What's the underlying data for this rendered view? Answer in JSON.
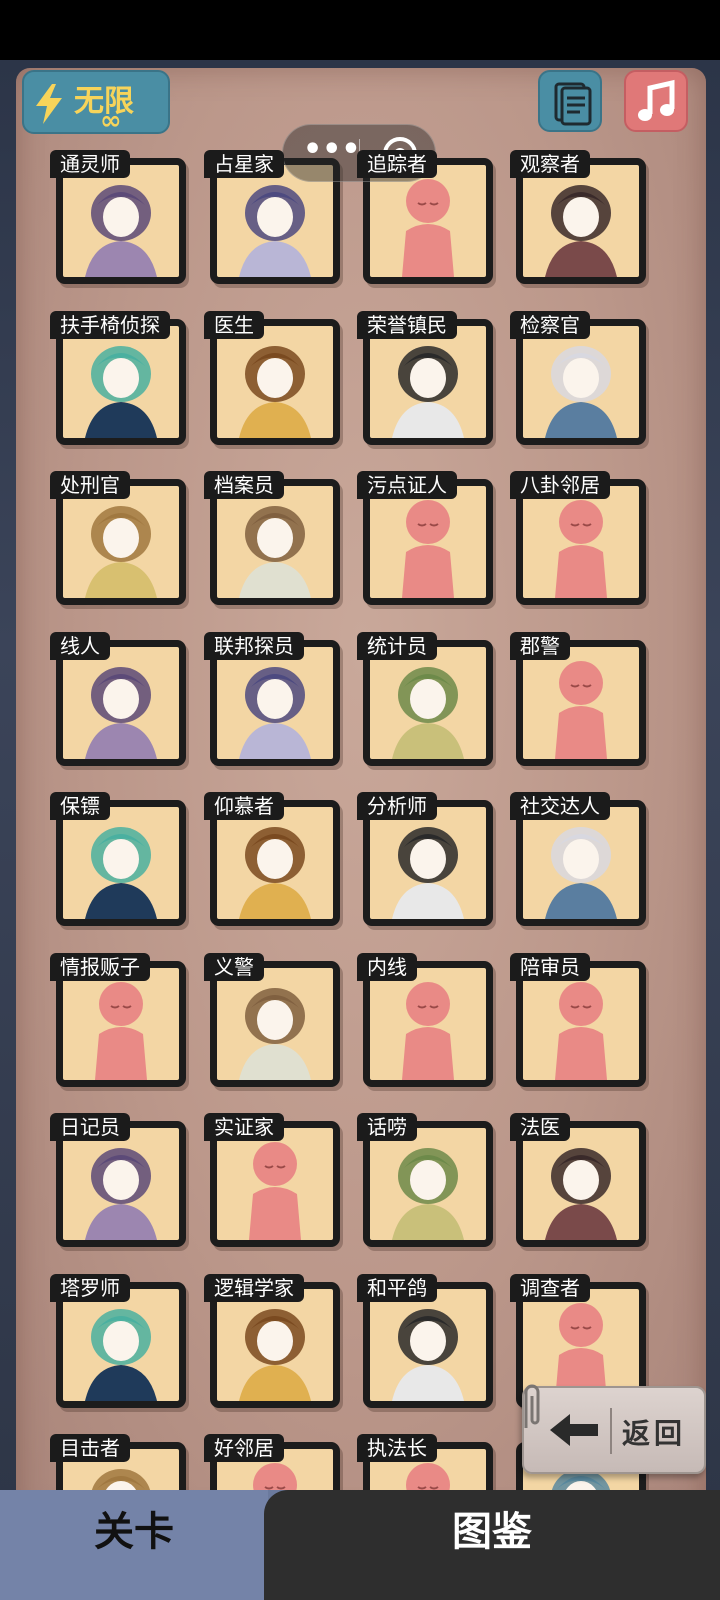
{
  "energy": {
    "label": "无限",
    "value": "∞"
  },
  "toolbar": {
    "notes_icon": "notes-icon",
    "music_icon": "music-note-icon"
  },
  "cards": [
    {
      "name": "通灵师",
      "figure": "portrait"
    },
    {
      "name": "占星家",
      "figure": "portrait"
    },
    {
      "name": "追踪者",
      "figure": "stickman"
    },
    {
      "name": "观察者",
      "figure": "portrait"
    },
    {
      "name": "扶手椅侦探",
      "figure": "portrait"
    },
    {
      "name": "医生",
      "figure": "portrait"
    },
    {
      "name": "荣誉镇民",
      "figure": "portrait"
    },
    {
      "name": "检察官",
      "figure": "portrait"
    },
    {
      "name": "处刑官",
      "figure": "portrait"
    },
    {
      "name": "档案员",
      "figure": "portrait"
    },
    {
      "name": "污点证人",
      "figure": "stickman"
    },
    {
      "name": "八卦邻居",
      "figure": "stickman"
    },
    {
      "name": "线人",
      "figure": "portrait"
    },
    {
      "name": "联邦探员",
      "figure": "portrait"
    },
    {
      "name": "统计员",
      "figure": "portrait"
    },
    {
      "name": "郡警",
      "figure": "stickman"
    },
    {
      "name": "保镖",
      "figure": "portrait"
    },
    {
      "name": "仰慕者",
      "figure": "portrait"
    },
    {
      "name": "分析师",
      "figure": "portrait"
    },
    {
      "name": "社交达人",
      "figure": "portrait"
    },
    {
      "name": "情报贩子",
      "figure": "stickman"
    },
    {
      "name": "义警",
      "figure": "portrait"
    },
    {
      "name": "内线",
      "figure": "stickman"
    },
    {
      "name": "陪审员",
      "figure": "stickman"
    },
    {
      "name": "日记员",
      "figure": "portrait"
    },
    {
      "name": "实证家",
      "figure": "stickman"
    },
    {
      "name": "话唠",
      "figure": "portrait"
    },
    {
      "name": "法医",
      "figure": "portrait"
    },
    {
      "name": "塔罗师",
      "figure": "portrait"
    },
    {
      "name": "逻辑学家",
      "figure": "portrait"
    },
    {
      "name": "和平鸽",
      "figure": "portrait"
    },
    {
      "name": "调查者",
      "figure": "stickman"
    },
    {
      "name": "目击者",
      "figure": "portrait"
    },
    {
      "name": "好邻居",
      "figure": "stickman"
    },
    {
      "name": "执法长",
      "figure": "stickman"
    },
    {
      "name": "",
      "figure": "portrait"
    }
  ],
  "return_button": {
    "label": "返回"
  },
  "tabs": [
    {
      "label": "关卡",
      "active": true
    },
    {
      "label": "图鉴",
      "active": false
    }
  ],
  "colors": {
    "card_bg": "#f3d6a4",
    "stickman": "#e98a86",
    "accent": "#4a8ea4"
  }
}
